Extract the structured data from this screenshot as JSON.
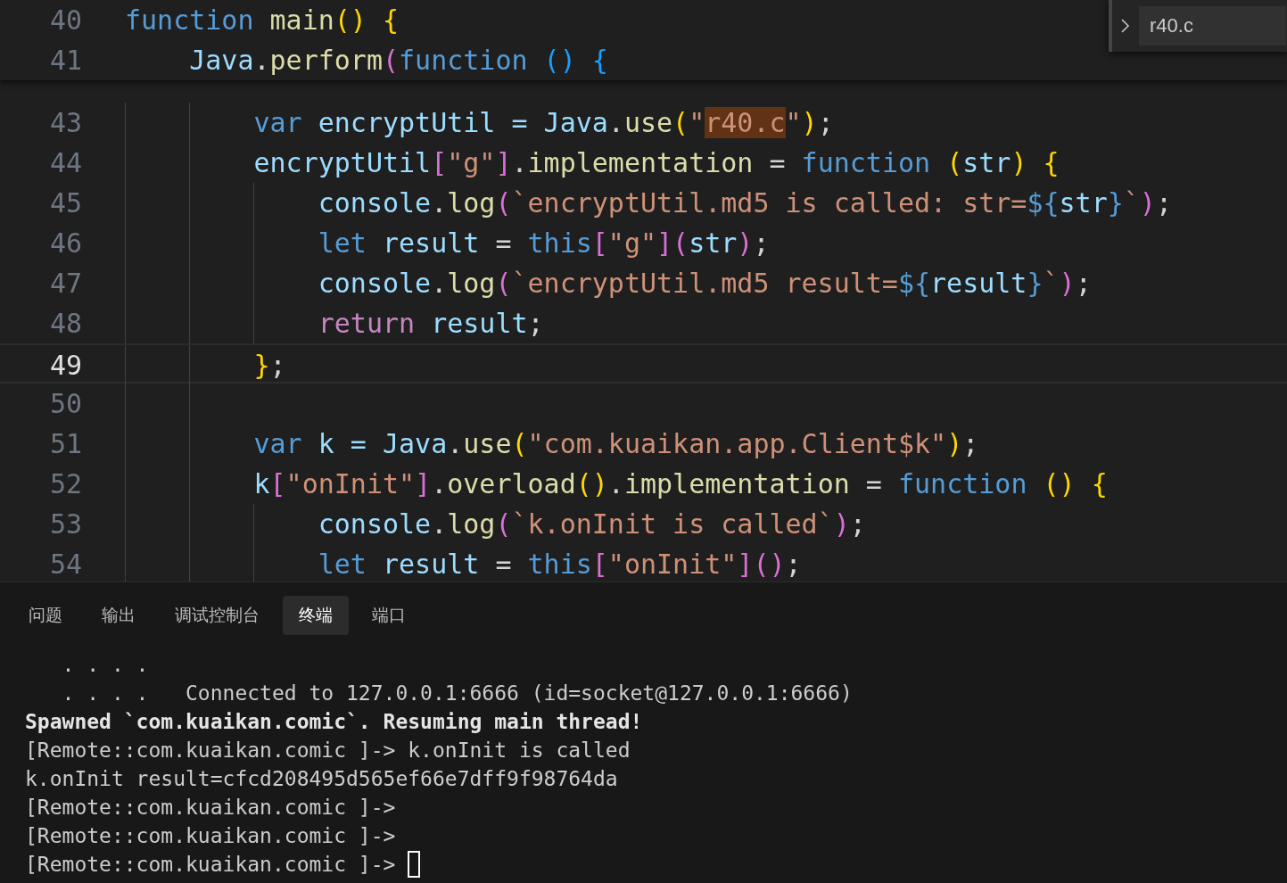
{
  "editor": {
    "sticky_lines": [
      {
        "number": "40",
        "tokens": [
          {
            "text": "function",
            "kind": "keyword"
          },
          {
            "text": " main",
            "kind": "func"
          },
          {
            "text": "()",
            "kind": "b1"
          },
          {
            "text": " {",
            "kind": "b1"
          }
        ]
      },
      {
        "number": "41",
        "tokens": [
          {
            "text": "    Java",
            "kind": "var"
          },
          {
            "text": ".",
            "kind": "plain"
          },
          {
            "text": "perform",
            "kind": "func"
          },
          {
            "text": "(",
            "kind": "b2"
          },
          {
            "text": "function",
            "kind": "keyword"
          },
          {
            "text": " ()",
            "kind": "b3"
          },
          {
            "text": " {",
            "kind": "b3"
          }
        ]
      }
    ],
    "lines": [
      {
        "number": "43",
        "current": false,
        "tokens": [
          {
            "text": "        var",
            "kind": "keyword"
          },
          {
            "text": " encryptUtil = ",
            "kind": "var"
          },
          {
            "text": "Java",
            "kind": "var"
          },
          {
            "text": ".",
            "kind": "plain"
          },
          {
            "text": "use",
            "kind": "func"
          },
          {
            "text": "(",
            "kind": "b1"
          },
          {
            "text": "\"",
            "kind": "string"
          },
          {
            "text": "r40.c",
            "kind": "match"
          },
          {
            "text": "\"",
            "kind": "string"
          },
          {
            "text": ")",
            "kind": "b1"
          },
          {
            "text": ";",
            "kind": "plain"
          }
        ]
      },
      {
        "number": "44",
        "current": false,
        "tokens": [
          {
            "text": "        encryptUtil",
            "kind": "var"
          },
          {
            "text": "[",
            "kind": "b2"
          },
          {
            "text": "\"g\"",
            "kind": "string"
          },
          {
            "text": "]",
            "kind": "b2"
          },
          {
            "text": ".",
            "kind": "plain"
          },
          {
            "text": "implementation",
            "kind": "func"
          },
          {
            "text": " = ",
            "kind": "plain"
          },
          {
            "text": "function",
            "kind": "keyword"
          },
          {
            "text": " (",
            "kind": "b1"
          },
          {
            "text": "str",
            "kind": "var"
          },
          {
            "text": ")",
            "kind": "b1"
          },
          {
            "text": " {",
            "kind": "b1"
          }
        ]
      },
      {
        "number": "45",
        "current": false,
        "tokens": [
          {
            "text": "            console",
            "kind": "var"
          },
          {
            "text": ".",
            "kind": "plain"
          },
          {
            "text": "log",
            "kind": "func"
          },
          {
            "text": "(",
            "kind": "b2"
          },
          {
            "text": "`encryptUtil.md5 is called: str=",
            "kind": "string"
          },
          {
            "text": "${",
            "kind": "keyword"
          },
          {
            "text": "str",
            "kind": "var"
          },
          {
            "text": "}",
            "kind": "keyword"
          },
          {
            "text": "`",
            "kind": "string"
          },
          {
            "text": ")",
            "kind": "b2"
          },
          {
            "text": ";",
            "kind": "plain"
          }
        ]
      },
      {
        "number": "46",
        "current": false,
        "tokens": [
          {
            "text": "            let",
            "kind": "keyword"
          },
          {
            "text": " result",
            "kind": "var"
          },
          {
            "text": " = ",
            "kind": "plain"
          },
          {
            "text": "this",
            "kind": "keyword"
          },
          {
            "text": "[",
            "kind": "b2"
          },
          {
            "text": "\"g\"",
            "kind": "string"
          },
          {
            "text": "](",
            "kind": "b2"
          },
          {
            "text": "str",
            "kind": "var"
          },
          {
            "text": ")",
            "kind": "b2"
          },
          {
            "text": ";",
            "kind": "plain"
          }
        ]
      },
      {
        "number": "47",
        "current": false,
        "tokens": [
          {
            "text": "            console",
            "kind": "var"
          },
          {
            "text": ".",
            "kind": "plain"
          },
          {
            "text": "log",
            "kind": "func"
          },
          {
            "text": "(",
            "kind": "b2"
          },
          {
            "text": "`encryptUtil.md5 result=",
            "kind": "string"
          },
          {
            "text": "${",
            "kind": "keyword"
          },
          {
            "text": "result",
            "kind": "var"
          },
          {
            "text": "}",
            "kind": "keyword"
          },
          {
            "text": "`",
            "kind": "string"
          },
          {
            "text": ")",
            "kind": "b2"
          },
          {
            "text": ";",
            "kind": "plain"
          }
        ]
      },
      {
        "number": "48",
        "current": false,
        "tokens": [
          {
            "text": "            return",
            "kind": "control"
          },
          {
            "text": " result",
            "kind": "var"
          },
          {
            "text": ";",
            "kind": "plain"
          }
        ]
      },
      {
        "number": "49",
        "current": true,
        "tokens": [
          {
            "text": "        }",
            "kind": "b1"
          },
          {
            "text": ";",
            "kind": "plain"
          }
        ]
      },
      {
        "number": "50",
        "current": false
      },
      {
        "number": "51",
        "current": false,
        "tokens": [
          {
            "text": "        var",
            "kind": "keyword"
          },
          {
            "text": " k = ",
            "kind": "var"
          },
          {
            "text": "Java",
            "kind": "var"
          },
          {
            "text": ".",
            "kind": "plain"
          },
          {
            "text": "use",
            "kind": "func"
          },
          {
            "text": "(",
            "kind": "b1"
          },
          {
            "text": "\"com.kuaikan.app.Client$k\"",
            "kind": "string"
          },
          {
            "text": ")",
            "kind": "b1"
          },
          {
            "text": ";",
            "kind": "plain"
          }
        ]
      },
      {
        "number": "52",
        "current": false,
        "tokens": [
          {
            "text": "        k",
            "kind": "var"
          },
          {
            "text": "[",
            "kind": "b2"
          },
          {
            "text": "\"onInit\"",
            "kind": "string"
          },
          {
            "text": "]",
            "kind": "b2"
          },
          {
            "text": ".",
            "kind": "plain"
          },
          {
            "text": "overload",
            "kind": "func"
          },
          {
            "text": "()",
            "kind": "b1"
          },
          {
            "text": ".",
            "kind": "plain"
          },
          {
            "text": "implementation",
            "kind": "func"
          },
          {
            "text": " = ",
            "kind": "plain"
          },
          {
            "text": "function",
            "kind": "keyword"
          },
          {
            "text": " ()",
            "kind": "b1"
          },
          {
            "text": " {",
            "kind": "b1"
          }
        ]
      },
      {
        "number": "53",
        "current": false,
        "tokens": [
          {
            "text": "            console",
            "kind": "var"
          },
          {
            "text": ".",
            "kind": "plain"
          },
          {
            "text": "log",
            "kind": "func"
          },
          {
            "text": "(",
            "kind": "b2"
          },
          {
            "text": "`k.onInit is called`",
            "kind": "string"
          },
          {
            "text": ")",
            "kind": "b2"
          },
          {
            "text": ";",
            "kind": "plain"
          }
        ]
      },
      {
        "number": "54",
        "current": false,
        "tokens": [
          {
            "text": "            let",
            "kind": "keyword"
          },
          {
            "text": " result",
            "kind": "var"
          },
          {
            "text": " = ",
            "kind": "plain"
          },
          {
            "text": "this",
            "kind": "keyword"
          },
          {
            "text": "[",
            "kind": "b2"
          },
          {
            "text": "\"onInit\"",
            "kind": "string"
          },
          {
            "text": "]",
            "kind": "b2"
          },
          {
            "text": "()",
            "kind": "b2"
          },
          {
            "text": ";",
            "kind": "plain"
          }
        ]
      }
    ],
    "find_widget": {
      "value": "r40.c"
    }
  },
  "panel": {
    "tabs": [
      {
        "label": "问题",
        "selected": false
      },
      {
        "label": "输出",
        "selected": false
      },
      {
        "label": "调试控制台",
        "selected": false
      },
      {
        "label": "终端",
        "selected": true
      },
      {
        "label": "端口",
        "selected": false
      }
    ],
    "terminal": [
      {
        "text": "   . . . .",
        "kind": "normal"
      },
      {
        "text": "   . . . .   Connected to 127.0.0.1:6666 (id=socket@127.0.0.1:6666)",
        "kind": "normal"
      },
      {
        "text": "Spawned `com.kuaikan.comic`. Resuming main thread!",
        "kind": "bold"
      },
      {
        "text": "[Remote::com.kuaikan.comic ]-> k.onInit is called",
        "kind": "normal"
      },
      {
        "text": "k.onInit result=cfcd208495d565ef66e7dff9f98764da",
        "kind": "normal"
      },
      {
        "text": "[Remote::com.kuaikan.comic ]->",
        "kind": "normal"
      },
      {
        "text": "[Remote::com.kuaikan.comic ]->",
        "kind": "normal"
      },
      {
        "text": "[Remote::com.kuaikan.comic ]->",
        "kind": "prompt",
        "cursor": true
      }
    ]
  }
}
